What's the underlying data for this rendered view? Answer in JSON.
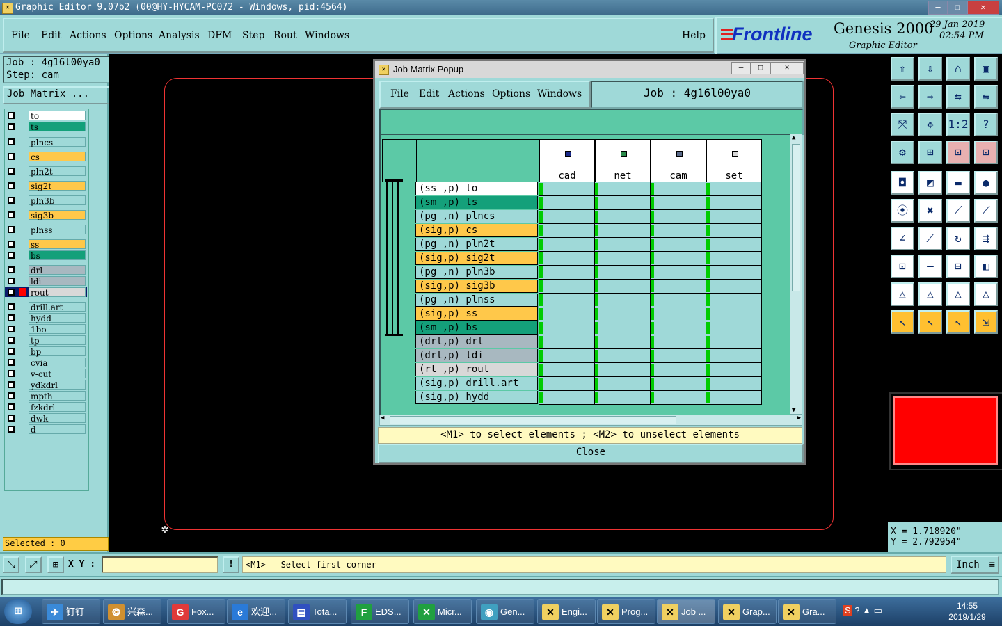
{
  "window": {
    "title": "Graphic Editor 9.07b2 (00@HY-HYCAM-PC072 - Windows, pid:4564)",
    "min": "—",
    "max": "❐",
    "close": "✕"
  },
  "menubar": {
    "items": [
      "File",
      "Edit",
      "Actions",
      "Options",
      "Analysis",
      "DFM",
      "Step",
      "Rout",
      "Windows"
    ],
    "help": "Help"
  },
  "brand": {
    "logo": "Frontline",
    "product": "Genesis 2000",
    "subtitle": "Graphic Editor",
    "date": "29  Jan  2019",
    "time": "02:54  PM"
  },
  "left": {
    "job": "Job : 4g16l00ya0",
    "step": "Step: cam",
    "job_matrix_button": "Job Matrix ...",
    "selected": "Selected : 0",
    "layers": [
      {
        "name": "to",
        "color": "#ffffff"
      },
      {
        "name": "ts",
        "color": "#14a07a"
      },
      {
        "name": "plncs",
        "color": "#9fd9d8"
      },
      {
        "name": "cs",
        "color": "#ffc84a"
      },
      {
        "name": "pln2t",
        "color": "#9fd9d8"
      },
      {
        "name": "sig2t",
        "color": "#ffc84a"
      },
      {
        "name": "pln3b",
        "color": "#9fd9d8"
      },
      {
        "name": "sig3b",
        "color": "#ffc84a"
      },
      {
        "name": "plnss",
        "color": "#9fd9d8"
      },
      {
        "name": "ss",
        "color": "#ffc84a"
      },
      {
        "name": "bs",
        "color": "#14a07a"
      },
      {
        "name": "drl",
        "color": "#a8b8c0"
      },
      {
        "name": "ldi",
        "color": "#a8b8c0"
      },
      {
        "name": "rout",
        "color": "#d8d8d8"
      },
      {
        "name": "drill.art",
        "color": "#9fd9d8"
      },
      {
        "name": "hydd",
        "color": "#9fd9d8"
      },
      {
        "name": "1bo",
        "color": "#9fd9d8"
      },
      {
        "name": "tp",
        "color": "#9fd9d8"
      },
      {
        "name": "bp",
        "color": "#9fd9d8"
      },
      {
        "name": "cvia",
        "color": "#9fd9d8"
      },
      {
        "name": "v-cut",
        "color": "#9fd9d8"
      },
      {
        "name": "ydkdrl",
        "color": "#9fd9d8"
      },
      {
        "name": "mpth",
        "color": "#9fd9d8"
      },
      {
        "name": "fzkdrl",
        "color": "#9fd9d8"
      },
      {
        "name": "dwk",
        "color": "#9fd9d8"
      },
      {
        "name": "d",
        "color": "#9fd9d8"
      }
    ]
  },
  "coords": {
    "x": "X = 1.718920\"",
    "y": "Y = 2.792954\""
  },
  "command": {
    "xy_label": "X Y :",
    "xy_value": "",
    "prompt": "<M1> - Select first corner",
    "units": "Inch"
  },
  "popup": {
    "title": "Job Matrix Popup",
    "menu": [
      "File",
      "Edit",
      "Actions",
      "Options",
      "Windows"
    ],
    "job": "Job : 4g16l00ya0",
    "columns": [
      "cad",
      "net",
      "cam",
      "set"
    ],
    "rows": [
      {
        "label": "(ss ,p) to",
        "color": "#ffffff"
      },
      {
        "label": "(sm ,p) ts",
        "color": "#14a07a"
      },
      {
        "label": "(pg ,n) plncs",
        "color": "#9fd9d8"
      },
      {
        "label": "(sig,p) cs",
        "color": "#ffc84a"
      },
      {
        "label": "(pg ,n) pln2t",
        "color": "#9fd9d8"
      },
      {
        "label": "(sig,p) sig2t",
        "color": "#ffc84a"
      },
      {
        "label": "(pg ,n) pln3b",
        "color": "#9fd9d8"
      },
      {
        "label": "(sig,p) sig3b",
        "color": "#ffc84a"
      },
      {
        "label": "(pg ,n) plnss",
        "color": "#9fd9d8"
      },
      {
        "label": "(sig,p) ss",
        "color": "#ffc84a"
      },
      {
        "label": "(sm ,p) bs",
        "color": "#14a07a"
      },
      {
        "label": "(drl,p) drl",
        "color": "#a8b8c0"
      },
      {
        "label": "(drl,p) ldi",
        "color": "#a8b8c0"
      },
      {
        "label": "(rt ,p) rout",
        "color": "#d8d8d8"
      },
      {
        "label": "(sig,p) drill.art",
        "color": "#9fd9d8"
      },
      {
        "label": "(sig,p) hydd",
        "color": "#9fd9d8"
      }
    ],
    "hint": "<M1> to select elements ; <M2> to unselect elements",
    "close": "Close"
  },
  "taskbar": {
    "items": [
      {
        "label": "钉钉",
        "icon": "dingtalk-icon"
      },
      {
        "label": "兴森...",
        "icon": "shell-icon"
      },
      {
        "label": "Fox...",
        "icon": "foxit-icon"
      },
      {
        "label": "欢迎...",
        "icon": "ie-icon"
      },
      {
        "label": "Tota...",
        "icon": "totalcmd-icon"
      },
      {
        "label": "EDS...",
        "icon": "eds-icon"
      },
      {
        "label": "Micr...",
        "icon": "excel-icon"
      },
      {
        "label": "Gen...",
        "icon": "genesis-icon"
      },
      {
        "label": "Engi...",
        "icon": "x-window-icon"
      },
      {
        "label": "Prog...",
        "icon": "x-window-icon"
      },
      {
        "label": "Job ...",
        "icon": "x-window-icon"
      },
      {
        "label": "Grap...",
        "icon": "x-window-icon"
      },
      {
        "label": "Gra...",
        "icon": "x-window-icon"
      }
    ],
    "time": "14:55",
    "date": "2019/1/29"
  }
}
